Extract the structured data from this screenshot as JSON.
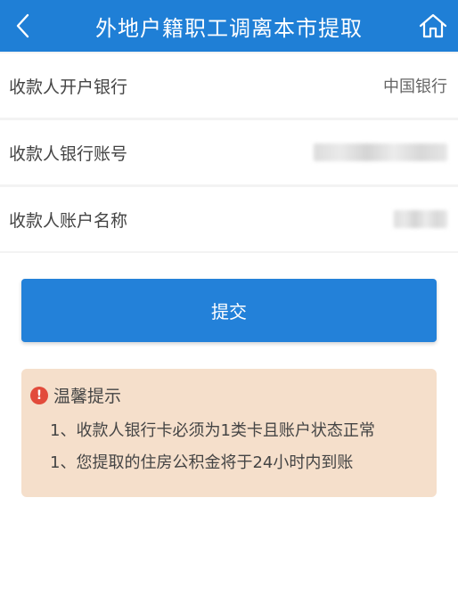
{
  "header": {
    "title": "外地户籍职工调离本市提取",
    "back_icon": "chevron-left-icon",
    "home_icon": "home-icon"
  },
  "form": {
    "bank_label": "收款人开户银行",
    "bank_value": "中国银行",
    "account_label": "收款人银行账号",
    "name_label": "收款人账户名称"
  },
  "submit_label": "提交",
  "tips": {
    "title": "温馨提示",
    "icon": "exclamation-icon",
    "lines": [
      "1、收款人银行卡必须为1类卡且账户状态正常",
      "1、您提取的住房公积金将于24小时内到账"
    ]
  },
  "colors": {
    "header_bg": "#1f7fd6",
    "button_bg": "#2381d9",
    "tip_bg": "#f5dfcb",
    "warn": "#e24b3b"
  }
}
